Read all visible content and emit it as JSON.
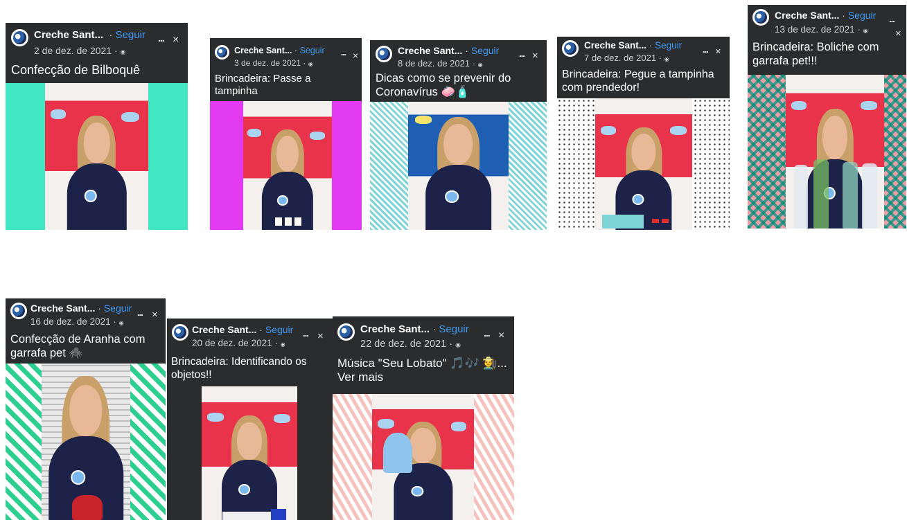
{
  "page": {
    "background": "#ffffff"
  },
  "colors": {
    "header_bg": "#2b2c2e",
    "follow": "#3d9bf5",
    "text": "#ffffff",
    "date": "#cfcfcf"
  },
  "cards": [
    {
      "name": "Creche Sant...",
      "follow": "Seguir",
      "date": "2 de dez. de 2021 ·",
      "caption": "Confecção de Bilboquê",
      "more": "...",
      "close": "×",
      "privacy_icon": "globe-icon",
      "background_pattern": "solid-mint"
    },
    {
      "name": "Creche Sant...",
      "follow": "Seguir",
      "date": "3 de dez. de 2021 ·",
      "caption": "Brincadeira: Passe a tampinha",
      "more": "...",
      "close": "×",
      "privacy_icon": "globe-icon",
      "background_pattern": "solid-magenta"
    },
    {
      "name": "Creche Sant...",
      "follow": "Seguir",
      "date": "8 de dez. de 2021 ·",
      "caption": "Dicas como se prevenir do Coronavírus 🧼🧴",
      "more": "...",
      "close": "×",
      "privacy_icon": "globe-icon",
      "background_pattern": "teal-stripes"
    },
    {
      "name": "Creche Sant...",
      "follow": "Seguir",
      "date": "7 de dez. de 2021 ·",
      "caption": "Brincadeira:  Pegue a tampinha com prendedor!",
      "more": "...",
      "close": "×",
      "privacy_icon": "globe-icon",
      "background_pattern": "black-dots"
    },
    {
      "name": "Creche Sant...",
      "follow": "Seguir",
      "date": "13 de dez. de 2021 ·",
      "caption": "Brincadeira: Boliche com garrafa pet!!!",
      "more": "...",
      "close": "×",
      "privacy_icon": "globe-icon",
      "background_pattern": "teal-pink-diamonds"
    },
    {
      "name": "Creche Sant...",
      "follow": "Seguir",
      "date": "16 de dez. de 2021 ·",
      "caption": "Confecção de Aranha com garrafa pet 🕷️",
      "more": "...",
      "close": "×",
      "privacy_icon": "globe-icon",
      "background_pattern": "green-zigzag"
    },
    {
      "name": "Creche Sant...",
      "follow": "Seguir",
      "date": "20 de dez. de 2021 ·",
      "caption": "Brincadeira: Identificando os objetos!!",
      "more": "...",
      "close": "×",
      "privacy_icon": "globe-icon",
      "background_pattern": "blue-pink-dots"
    },
    {
      "name": "Creche Sant...",
      "follow": "Seguir",
      "date": "22 de dez. de 2021 ·",
      "caption": "Música \"Seu Lobato\" 🎵🎶 🧑‍🌾... Ver mais",
      "more": "...",
      "close": "×",
      "privacy_icon": "globe-icon",
      "background_pattern": "pink-sprinkles"
    }
  ]
}
